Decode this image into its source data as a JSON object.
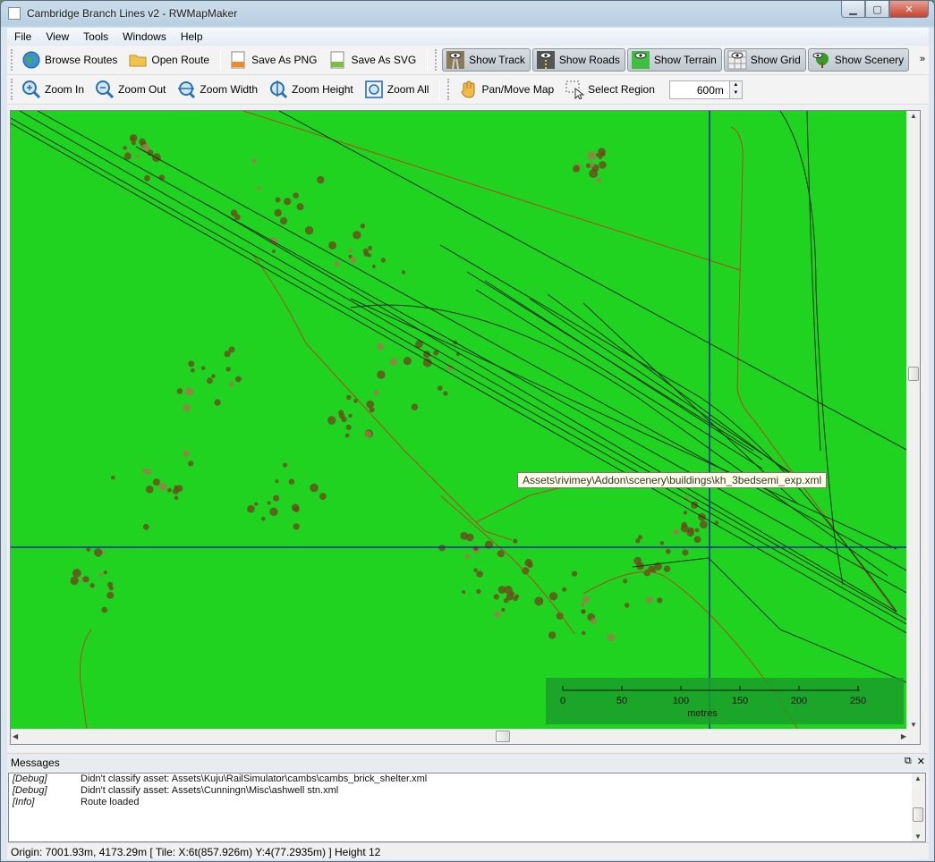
{
  "window": {
    "title": "Cambridge Branch Lines v2 - RWMapMaker"
  },
  "menu": [
    "File",
    "View",
    "Tools",
    "Windows",
    "Help"
  ],
  "toolbar1": {
    "browse_routes": "Browse Routes",
    "open_route": "Open Route",
    "save_png": "Save As PNG",
    "save_svg": "Save As SVG",
    "show_track": "Show Track",
    "show_roads": "Show Roads",
    "show_terrain": "Show Terrain",
    "show_grid": "Show Grid",
    "show_scenery": "Show Scenery",
    "overflow": "»"
  },
  "toolbar2": {
    "zoom_in": "Zoom In",
    "zoom_out": "Zoom Out",
    "zoom_width": "Zoom Width",
    "zoom_height": "Zoom Height",
    "zoom_all": "Zoom All",
    "pan_move": "Pan/Move Map",
    "select_region": "Select Region",
    "region_size": "600m"
  },
  "map": {
    "tooltip": "Assets\\rivimey\\Addon\\scenery\\buildings\\kh_3bedsemi_exp.xml",
    "scale_ticks": [
      "0",
      "50",
      "100",
      "150",
      "200",
      "250"
    ],
    "scale_unit": "metres",
    "colors": {
      "ground": "#21d321",
      "track": "#103010",
      "road": "#b04a1a",
      "tree": "#6a4a1a",
      "crosshair": "#1a2a9a"
    }
  },
  "messages": {
    "title": "Messages",
    "rows": [
      {
        "level": "[Debug]",
        "text": "Didn't classify asset: Assets\\Kuju\\RailSimulator\\cambs\\cambs_brick_shelter.xml"
      },
      {
        "level": "[Debug]",
        "text": "Didn't classify asset: Assets\\Cunningn\\Misc\\ashwell stn.xml"
      },
      {
        "level": "[Info]",
        "text": "Route loaded"
      }
    ]
  },
  "status": "Origin: 7001.93m, 4173.29m [ Tile: X:6t(857.926m)  Y:4(77.2935m) ]  Height 12"
}
